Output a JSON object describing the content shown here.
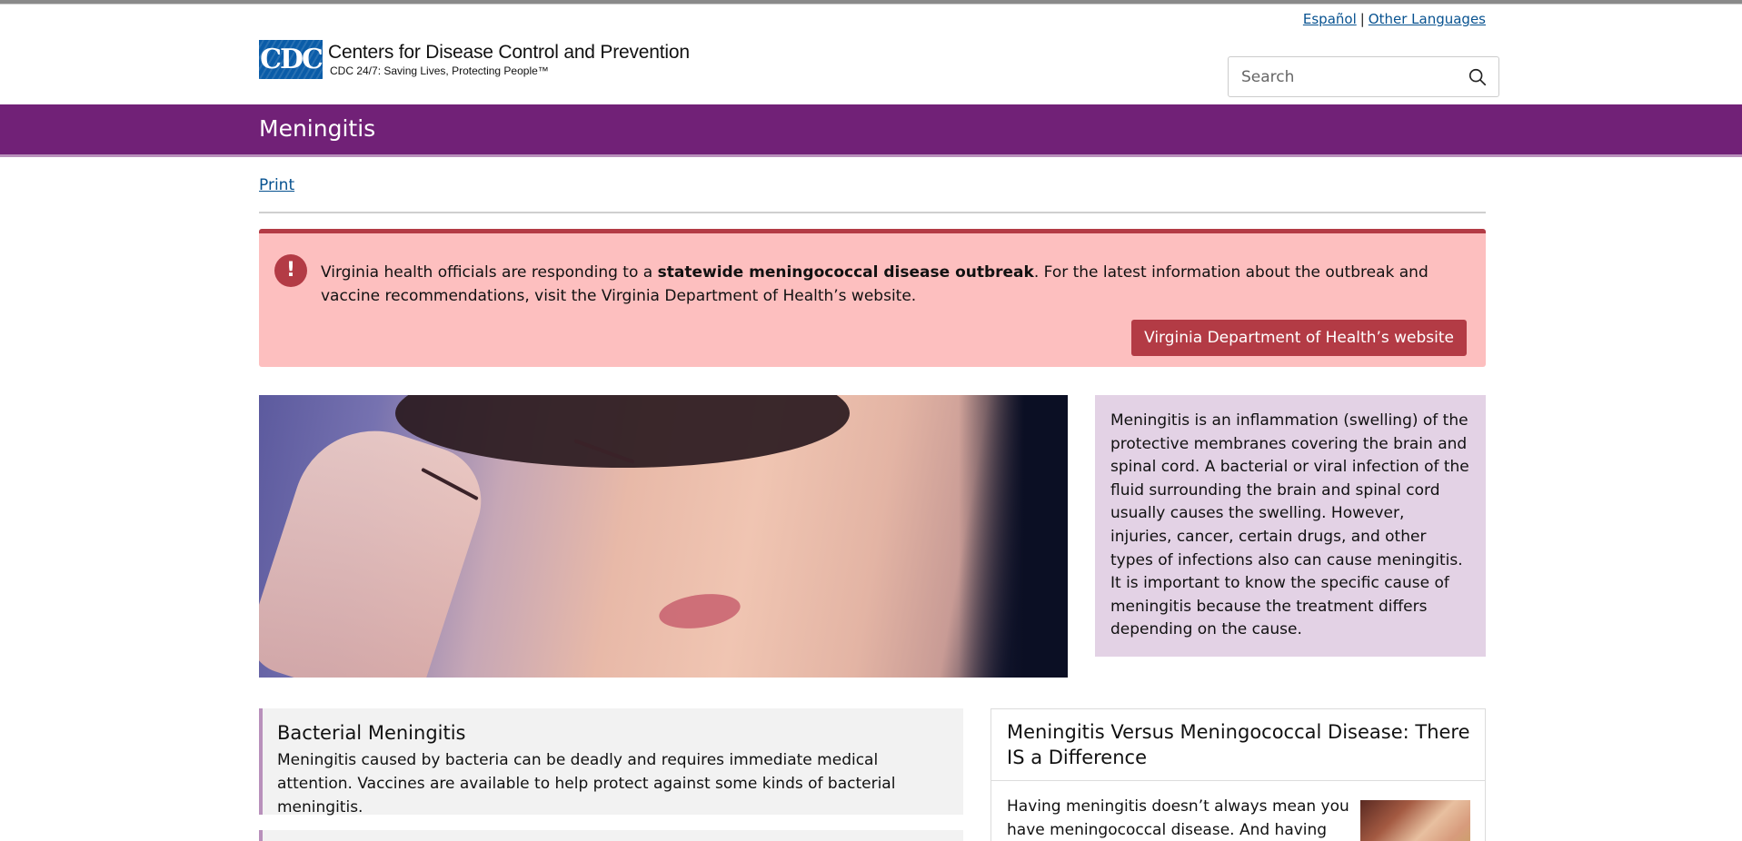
{
  "header": {
    "lang_links": [
      "Español",
      "Other Languages"
    ],
    "logo_mark": "CDC",
    "org_name": "Centers for Disease Control and Prevention",
    "tagline": "CDC 24/7: Saving Lives, Protecting People™",
    "search_placeholder": "Search"
  },
  "page": {
    "title": "Meningitis",
    "print_label": "Print"
  },
  "alert": {
    "icon": "!",
    "text_before": "Virginia health officials are responding to a ",
    "text_bold": "statewide meningococcal disease outbreak",
    "text_after": ". For the latest information about the outbreak and vaccine recommendations, visit the Virginia Department of Health’s website.",
    "button_label": "Virginia Department of Health’s website"
  },
  "definition": {
    "text": "Meningitis is an inflammation (swelling) of the protective membranes covering the brain and spinal cord. A bacterial or viral infection of the fluid surrounding the brain and spinal cord usually causes the swelling. However, injuries, cancer, certain drugs, and other types of infections also can cause meningitis. It is important to know the specific cause of meningitis because the treatment differs depending on the cause."
  },
  "cards": {
    "bacterial": {
      "title": "Bacterial Meningitis",
      "text": "Meningitis caused by bacteria can be deadly and requires immediate medical attention. Vaccines are available to help protect against some kinds of bacterial meningitis."
    },
    "versus": {
      "title": "Meningitis Versus Meningococcal Disease: There IS a Difference",
      "text": "Having meningitis doesn’t always mean you have meningococcal disease. And having"
    }
  },
  "colors": {
    "brand_purple": "#712177",
    "alert_bg": "#fdbfbf",
    "alert_accent": "#b33b45",
    "definition_bg": "#e3d2e5",
    "link": "#075290"
  },
  "icons": {
    "search": "search-icon",
    "alert": "exclamation-icon"
  }
}
